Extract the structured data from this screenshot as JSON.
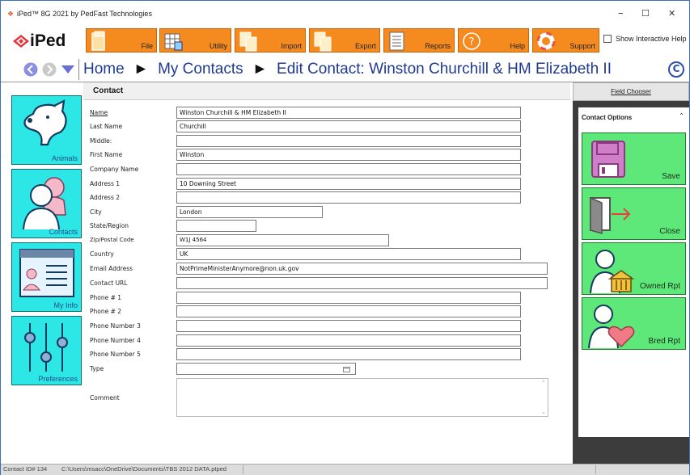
{
  "window": {
    "title": "iPed™ 8G 2021 by PedFast Technologies",
    "minimize": "–",
    "maximize": "☐",
    "close": "✕"
  },
  "brand": {
    "name": "iPed"
  },
  "toolbar": {
    "buttons": [
      {
        "label": "File",
        "icon": "file-icon"
      },
      {
        "label": "Utility",
        "icon": "utility-icon"
      },
      {
        "label": "Import",
        "icon": "import-icon"
      },
      {
        "label": "Export",
        "icon": "export-icon"
      },
      {
        "label": "Reports",
        "icon": "reports-icon"
      },
      {
        "label": "Help",
        "icon": "help-icon"
      },
      {
        "label": "Support",
        "icon": "support-icon"
      }
    ],
    "show_interactive_help": "Show Interactive Help"
  },
  "breadcrumb": {
    "items": [
      "Home",
      "My Contacts",
      "Edit Contact: Winston Churchill & HM Elizabeth II"
    ],
    "separator": "►",
    "refresh": "C"
  },
  "sidebar": {
    "items": [
      {
        "label": "Animals",
        "icon": "dog-icon"
      },
      {
        "label": "Contacts",
        "icon": "people-icon"
      },
      {
        "label": "My Info",
        "icon": "id-card-icon"
      },
      {
        "label": "Preferences",
        "icon": "sliders-icon"
      }
    ]
  },
  "form": {
    "section_title": "Contact",
    "fields": [
      {
        "label": "Name",
        "value": "Winston Churchill & HM Elizabeth II"
      },
      {
        "label": "Last Name",
        "value": "Churchill"
      },
      {
        "label": "Middle:",
        "value": ""
      },
      {
        "label": "First Name",
        "value": "Winston"
      },
      {
        "label": "Company Name",
        "value": ""
      },
      {
        "label": "Address 1",
        "value": "10 Downing Street"
      },
      {
        "label": "Address 2",
        "value": ""
      },
      {
        "label": "City",
        "value": "London"
      },
      {
        "label": "State/Region",
        "value": ""
      },
      {
        "label": "Zip/Postal Code",
        "value": "W1J 4564"
      },
      {
        "label": "Country",
        "value": "UK"
      },
      {
        "label": "Email Address",
        "value": "NotPrimeMinisterAnymore@non.uk.gov"
      },
      {
        "label": "Contact URL",
        "value": ""
      },
      {
        "label": "Phone # 1",
        "value": ""
      },
      {
        "label": "Phone # 2",
        "value": ""
      },
      {
        "label": "Phone Number 3",
        "value": ""
      },
      {
        "label": "Phone Number 4",
        "value": ""
      },
      {
        "label": "Phone Number 5",
        "value": ""
      },
      {
        "label": "Type",
        "value": ""
      },
      {
        "label": "Comment",
        "value": ""
      }
    ]
  },
  "right_panel": {
    "field_chooser": "Field Chooser",
    "options_title": "Contact Options",
    "collapse": "⌃",
    "buttons": [
      {
        "label": "Save",
        "icon": "floppy-disk-icon"
      },
      {
        "label": "Close",
        "icon": "exit-door-icon"
      },
      {
        "label": "Owned Rpt",
        "icon": "owner-report-icon"
      },
      {
        "label": "Bred Rpt",
        "icon": "breeder-report-icon"
      }
    ]
  },
  "status": {
    "contact_id": "Contact ID# 134",
    "file_path": "C:\\Users\\msacc\\OneDrive\\Documents\\TBS 2012 DATA.ptped"
  },
  "colors": {
    "toolbar_orange": "#f58a1f",
    "nav_cyan": "#2de6e6",
    "option_green": "#5ee87a",
    "panel_dark": "#3c3c3c",
    "breadcrumb_blue": "#1f3a8f"
  }
}
